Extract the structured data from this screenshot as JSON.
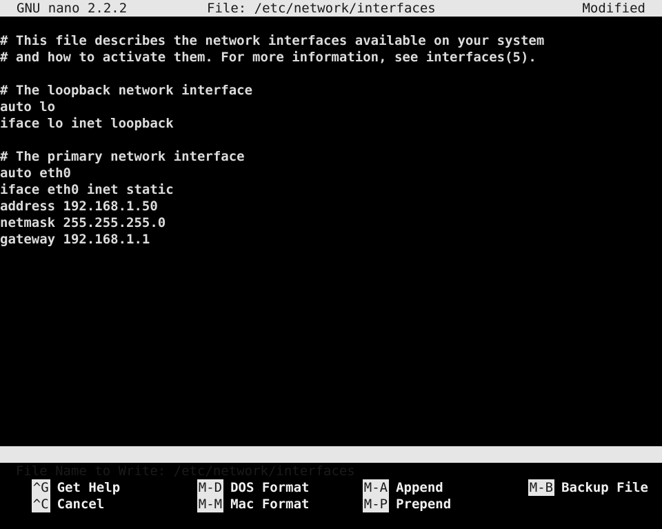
{
  "titlebar": {
    "app": "GNU nano 2.2.2",
    "file": "File: /etc/network/interfaces",
    "status": "Modified"
  },
  "editor": {
    "lines": [
      "# This file describes the network interfaces available on your system",
      "# and how to activate them. For more information, see interfaces(5).",
      "",
      "# The loopback network interface",
      "auto lo",
      "iface lo inet loopback",
      "",
      "# The primary network interface",
      "auto eth0",
      "iface eth0 inet static",
      "address 192.168.1.50",
      "netmask 255.255.255.0",
      "gateway 192.168.1.1"
    ]
  },
  "prompt": {
    "label": "File Name to Write: ",
    "value": "/etc/network/interfaces"
  },
  "shortcuts": [
    {
      "key": "^G",
      "label": "Get Help"
    },
    {
      "key": "M-D",
      "label": "DOS Format"
    },
    {
      "key": "M-A",
      "label": "Append"
    },
    {
      "key": "M-B",
      "label": "Backup File"
    },
    {
      "key": "^C",
      "label": "Cancel"
    },
    {
      "key": "M-M",
      "label": "Mac Format"
    },
    {
      "key": "M-P",
      "label": "Prepend"
    }
  ]
}
